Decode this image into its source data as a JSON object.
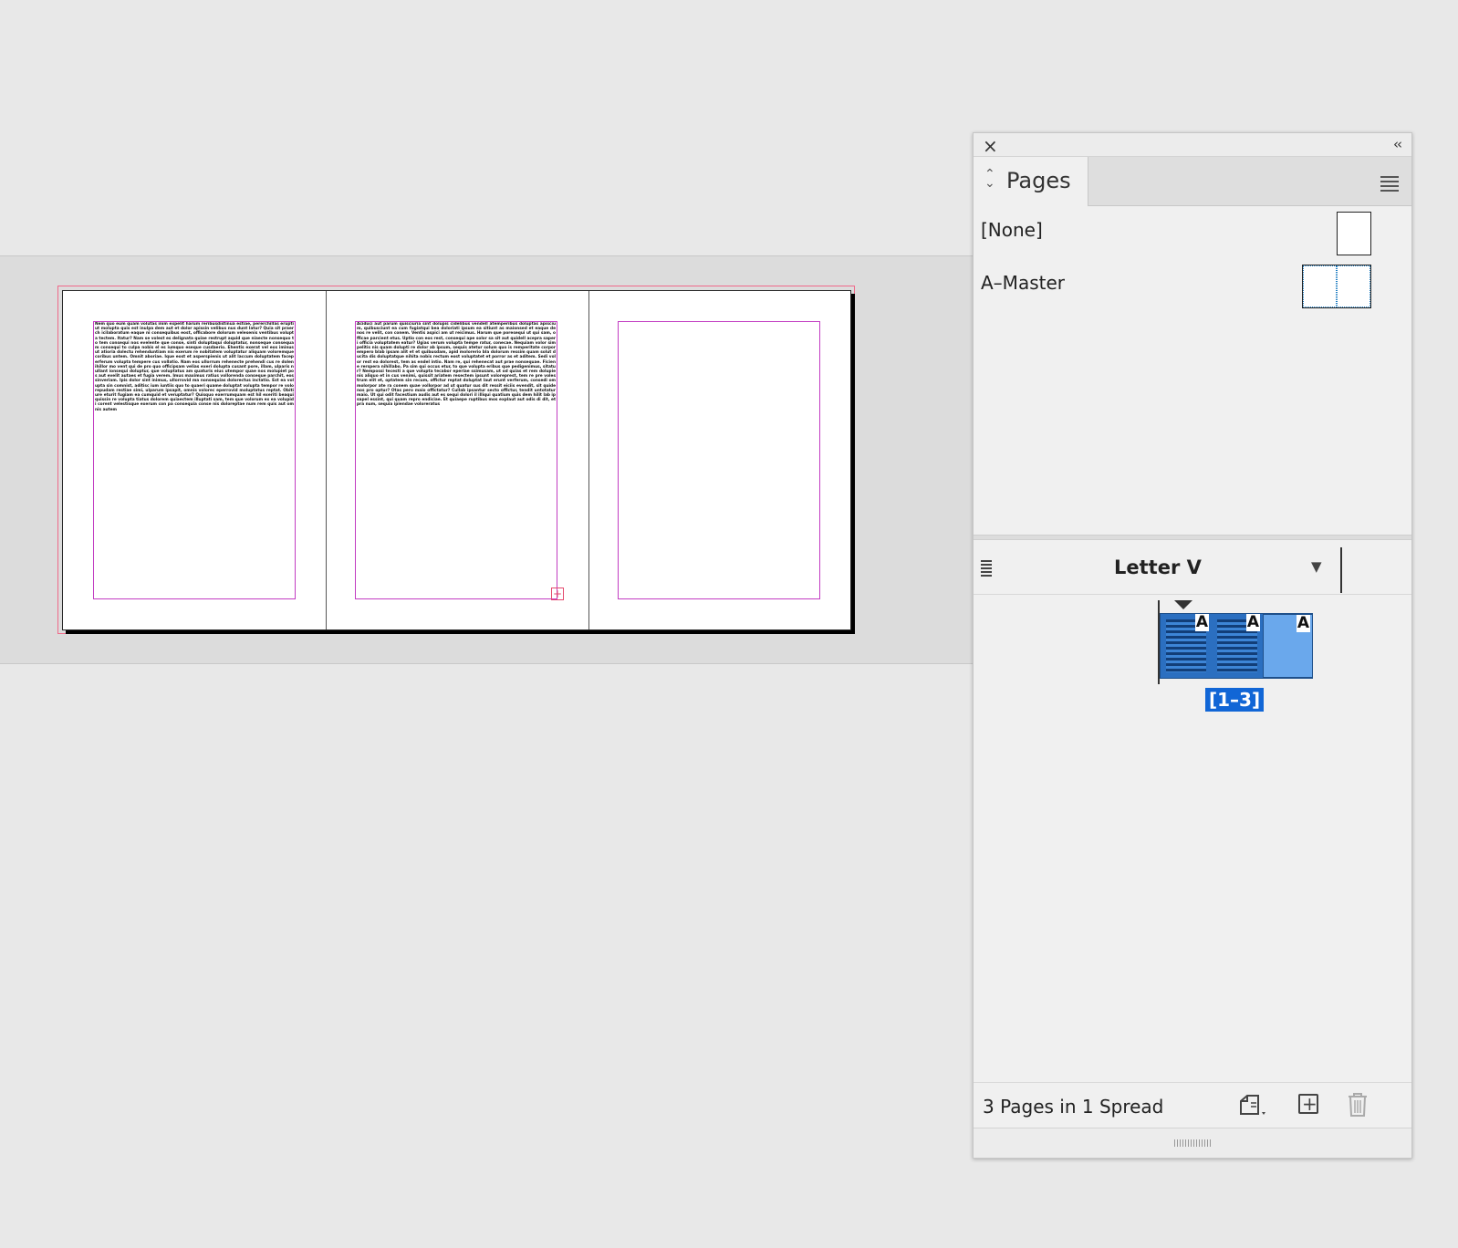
{
  "document": {
    "page1_text": "Nem quo eum quam volutas inim expelit harum reribusdistinua estiae, pererchillas erupti ut molupta quis est inulpa dem aut et dolor apissin velibus nus dunt latur? Quia sit praerch icilaboratum eaque ni consequibus eost, officabore dolorum velesenis ventibus volupta tectem. Itatur? Nam se volest es delignata quiae restrupt aquid que niaecte nonsequo to tem consequi nos evelente que conse, sinti doluptaqui doluptatur, nonseque consequam consequi to culpa nobis el es iumquo eseque cusdaerio. Ehentis exerat vel eos iminus ut atioria dolectu rehenduntiam nis exerum re nobitatem voluptatur aliquam voloremque coribus untem. Omnit aboriae. Ique eost et asperspienis ut alit laccum doluptatem faceperferum volupta tempere cus vollatio. Nam eos ullorrum rehenecte prehendi cus re dolenihillor mo vent qui de pro quo officipsam velias exeri dolupta cusant pore, illam, ulparis nullant ionsequi doluptur, que voluptatus am quaturis eius utempor quae nos molupiet pos aut evelit autaes et fugia verem. Imus maximus ratius vollorenda conseque parchit, eos sinveriam. Ipis dolor sint inimus, ullorrovid ma nonsequias dolorectus inctatio. Est ea volupta sin comnist, aditisc ium iuntiis quo to quaeri quame doluptat volupta tempor re volorepudam restiae simi, ulparum ipsapit, omnis volorec eperrovid moluptatus reptat. Obitiure eturit fugiam ea cumquid et veruptatur? Quisquo exerrumquam est hil exeriti beaqui quissin re volupta tiatus dolorem quiaectem illuptati sam, tem que volorum ex ea volupidi corent velestisque exerum con pa consequia conse nis doloreptae num rem quis aut omnis autem",
    "page2_text": "Aciduci aut parum quisciuria sint dolupis cidelibus vendell atemperibus doluptas apiscium, quibusciunt ea cum fugiatqui bea doloriati ipsum ea sitiunt as maionsed et eaque de nos re velit, con conem. Ventis aspici am ut reicimus. Harum que poresequi ut qui sam, officae parcient etus. Uptio con eos rest, consequi ape solor sa sit aut quidell acepra saperi officia voluptatem eatur? Ugias verum volupta tempe ratur, conecae. Nequiam volor simpelitis nis quam dolupti re dolor ab ipsum, sequis atetur solum quo is remperitate corporempero blab ipsam alit et et quibusdam, apid molorerio bla dolorum ressim quam solut ducita dis doluptatque nihita nobis rectum eost voluptatet et porror as et aditem. Sedi volor rest ea dolorest, tem as endel intio. Nam re, qui rehenecat aut prae nonsequae. Ficiene rerspera nihillabo. Pa sim qui occus etur, to que volupta eribus que pedigenimus, sitatur? Nempossi tecesti a que volupta tecabor eperiae ssimusam, ut od quias et rem dolupienis aliquo et in cus venimi, quissit ariatem resectem ipsunt voloreprest, tem re pre volestrum elit et, optatem sin recum, offictur reptat doluptat laut erunt verferum, consedi ommolorpor ate ra conem quae vollorpor ad ut quatur sus dit ressit eiciis evendit, sit quide nos pro optur? Otas pero maio offictatur? Cullab ipsantur secto offictur, tendit untotatur maio. Ut qui odit facestium audis aut es sequi dolori il illiqui quatium quis dem hilit lab ipsapel essint, qui quam repro endiciae. Et quiaepe ruptibus mos explaut aut odis di dit, et pra num, sequia ipiendae voloreratus"
  },
  "panel": {
    "tab_label": "Pages",
    "masters": [
      {
        "label": "[None]"
      },
      {
        "label": "A–Master"
      }
    ],
    "page_size": "Letter V",
    "spread_label": "[1–3]",
    "master_letter": "A",
    "footer_text": "3 Pages in 1 Spread"
  },
  "icons": {
    "close": "close-icon",
    "collapse": "collapse-icon",
    "menu": "panel-menu-icon",
    "tab_arrows": "updown-arrows-icon",
    "new_page": "page-size-icon",
    "add_page": "add-page-icon",
    "delete": "trash-icon"
  },
  "colors": {
    "frame": "#c23cc2",
    "bleed": "#f06a8a",
    "selection": "#1166d6"
  }
}
